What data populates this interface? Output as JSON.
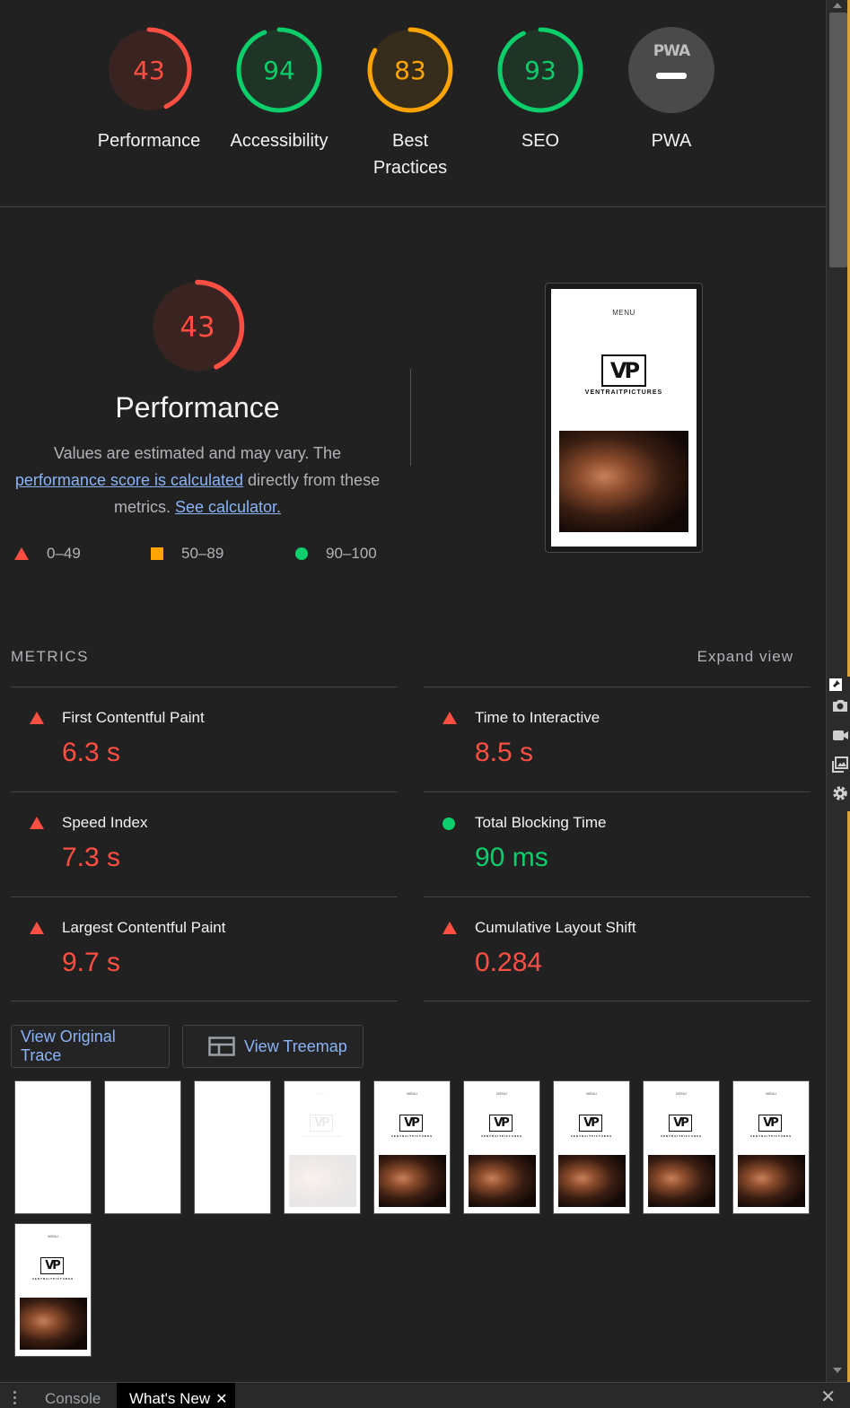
{
  "colors": {
    "fail": "#ff4e42",
    "average": "#ffa400",
    "pass": "#0cce6b",
    "pwa": "#9aa0a6"
  },
  "gauges": [
    {
      "score": 43,
      "label": "Performance",
      "status": "fail"
    },
    {
      "score": 94,
      "label": "Accessibility",
      "status": "pass"
    },
    {
      "score": 83,
      "label": "Best Practices",
      "status": "average"
    },
    {
      "score": 93,
      "label": "SEO",
      "status": "pass"
    },
    {
      "score": null,
      "label": "PWA",
      "status": "pwa",
      "badge_text": "PWA"
    }
  ],
  "performance": {
    "score": 43,
    "title": "Performance",
    "desc_prefix": "Values are estimated and may vary. The ",
    "desc_link": "performance score is calculated",
    "desc_mid": " directly from these metrics. ",
    "desc_link2": "See calculator.",
    "legend": [
      "0–49",
      "50–89",
      "90–100"
    ]
  },
  "preview": {
    "menu": "MENU",
    "logo": "VP",
    "brand": "VENTRAITPICTURES"
  },
  "metrics": {
    "heading": "METRICS",
    "expand": "Expand view",
    "items": [
      {
        "title": "First Contentful Paint",
        "value": "6.3 s",
        "status": "fail"
      },
      {
        "title": "Time to Interactive",
        "value": "8.5 s",
        "status": "fail"
      },
      {
        "title": "Speed Index",
        "value": "7.3 s",
        "status": "fail"
      },
      {
        "title": "Total Blocking Time",
        "value": "90 ms",
        "status": "pass"
      },
      {
        "title": "Largest Contentful Paint",
        "value": "9.7 s",
        "status": "fail"
      },
      {
        "title": "Cumulative Layout Shift",
        "value": "0.284",
        "status": "fail"
      }
    ]
  },
  "buttons": {
    "trace": "View Original Trace",
    "treemap": "View Treemap"
  },
  "filmstrip": [
    "blank",
    "blank",
    "blank",
    "faded",
    "full",
    "full",
    "full",
    "full",
    "full",
    "full"
  ],
  "drawer": {
    "tabs": [
      "Console",
      "What's New"
    ],
    "active": "What's New",
    "close_glyph": "✕"
  }
}
